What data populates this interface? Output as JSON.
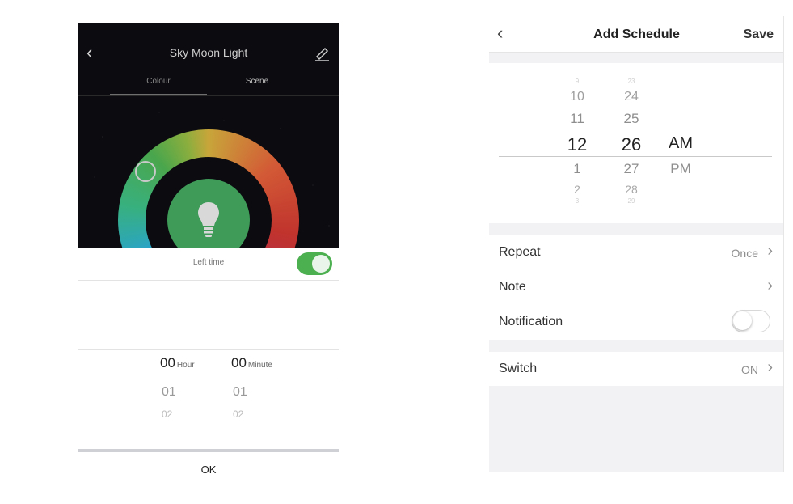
{
  "left": {
    "header": {
      "title": "Sky Moon Light"
    },
    "tabs": [
      {
        "label": "Colour"
      },
      {
        "label": "Scene"
      }
    ],
    "left_time": {
      "label": "Left time",
      "enabled": true
    },
    "timer_picker": {
      "hour_value": "00",
      "hour_unit": "Hour",
      "minute_value": "00",
      "minute_unit": "Minute",
      "below_1": "01",
      "below_2": "02"
    },
    "ok_label": "OK",
    "colors": {
      "accent_green": "#4caf50",
      "bulb_green": "#3e9b58",
      "background": "#0b0b10"
    }
  },
  "right": {
    "header": {
      "title": "Add Schedule",
      "save_label": "Save"
    },
    "time_picker": {
      "hours": [
        "9",
        "10",
        "11",
        "12",
        "1",
        "2",
        "3"
      ],
      "minutes": [
        "23",
        "24",
        "25",
        "26",
        "27",
        "28",
        "29"
      ],
      "ampm": [
        "AM",
        "PM"
      ],
      "selected_hour": "12",
      "selected_minute": "26",
      "selected_ampm": "AM"
    },
    "rows": {
      "repeat": {
        "label": "Repeat",
        "value": "Once"
      },
      "note": {
        "label": "Note"
      },
      "notification": {
        "label": "Notification",
        "enabled": false
      },
      "switch": {
        "label": "Switch",
        "value": "ON"
      }
    }
  }
}
